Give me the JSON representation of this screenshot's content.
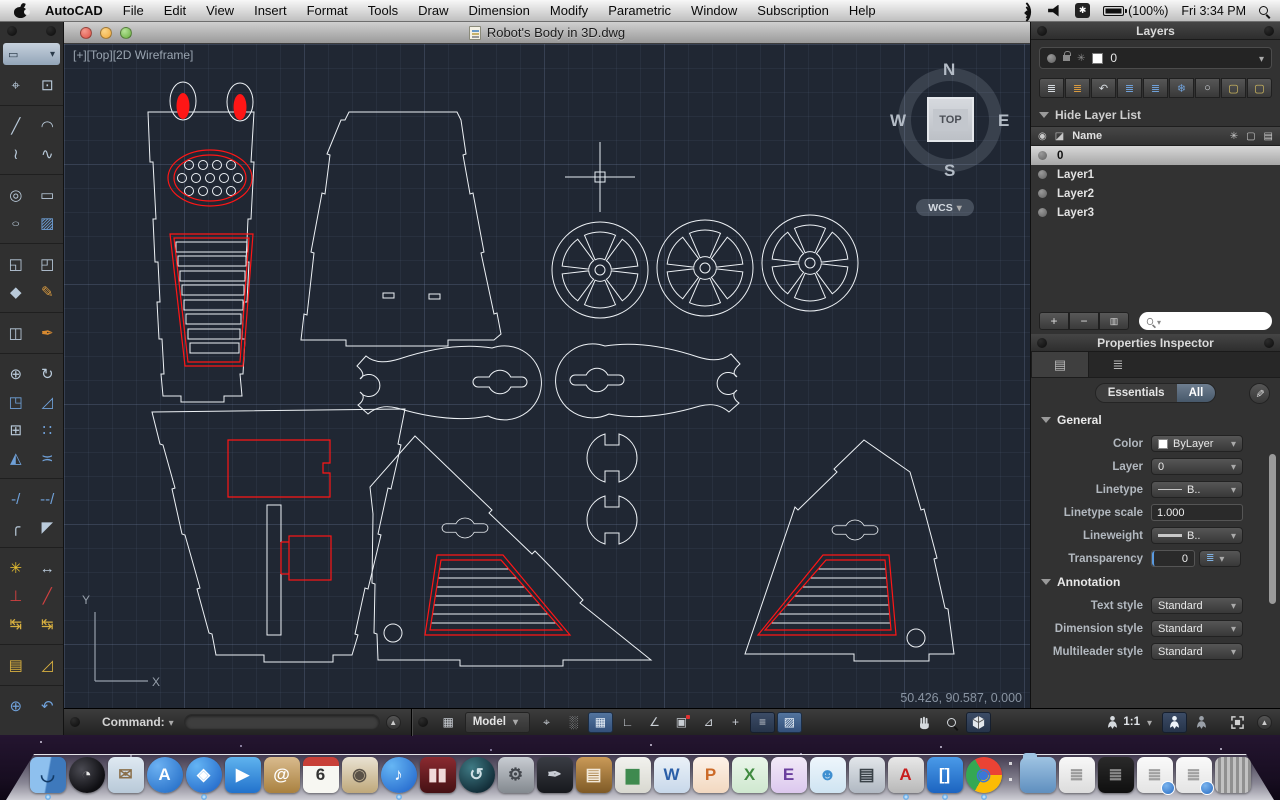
{
  "menubar": {
    "items": [
      "AutoCAD",
      "File",
      "Edit",
      "View",
      "Insert",
      "Format",
      "Tools",
      "Draw",
      "Dimension",
      "Modify",
      "Parametric",
      "Window",
      "Subscription",
      "Help"
    ],
    "battery": "(100%)",
    "clock": "Fri 3:34 PM"
  },
  "window": {
    "title": "Robot's Body in 3D.dwg",
    "viewport_label": "[+][Top][2D Wireframe]"
  },
  "compass": {
    "n": "N",
    "w": "W",
    "e": "E",
    "s": "S",
    "top": "TOP",
    "wcs": "WCS"
  },
  "canvas": {
    "coordinates": "50.426, 90.587, 0.000",
    "ucs_x": "X",
    "ucs_y": "Y",
    "background": "#202733",
    "line_color": "#edf1f5",
    "highlight_color": "#ff1616"
  },
  "layers": {
    "title": "Layers",
    "current": "0",
    "hide_label": "Hide Layer List",
    "name_col": "Name",
    "rows": [
      {
        "name": "0",
        "selected": true
      },
      {
        "name": "Layer1",
        "selected": false
      },
      {
        "name": "Layer2",
        "selected": false
      },
      {
        "name": "Layer3",
        "selected": false
      }
    ],
    "toolbar": [
      {
        "name": "layer-walk",
        "g": "≣",
        "c": "#d8dde2"
      },
      {
        "name": "layer-match",
        "g": "≣",
        "c": "#d89a40"
      },
      {
        "name": "layer-previous",
        "g": "↶",
        "c": "#d8dde2"
      },
      {
        "name": "layer-set-current",
        "g": "≣",
        "c": "#6fa0d8"
      },
      {
        "name": "layer-merge",
        "g": "≣",
        "c": "#6fa0d8"
      },
      {
        "name": "layer-freeze",
        "g": "❄",
        "c": "#6fa0d8"
      },
      {
        "name": "layer-off",
        "g": "○",
        "c": "#d8dde2"
      },
      {
        "name": "layer-lock",
        "g": "▢",
        "c": "#d8c060"
      },
      {
        "name": "layer-unlock",
        "g": "▢",
        "c": "#d8c060"
      }
    ],
    "footer": {
      "add": "+",
      "remove": "−",
      "columns": "▥"
    }
  },
  "properties": {
    "title": "Properties Inspector",
    "seg_essentials": "Essentials",
    "seg_all": "All",
    "general": {
      "title": "General",
      "color_label": "Color",
      "color_value": "ByLayer",
      "layer_label": "Layer",
      "layer_value": "0",
      "linetype_label": "Linetype",
      "linetype_value": "B..",
      "ltscale_label": "Linetype scale",
      "ltscale_value": "1.000",
      "lineweight_label": "Lineweight",
      "lineweight_value": "B..",
      "transparency_label": "Transparency",
      "transparency_value": "0"
    },
    "annotation": {
      "title": "Annotation",
      "text_style_label": "Text style",
      "text_style_value": "Standard",
      "dim_style_label": "Dimension style",
      "dim_style_value": "Standard",
      "mleader_label": "Multileader style",
      "mleader_value": "Standard"
    }
  },
  "command": {
    "label": "Command:"
  },
  "statusbar": {
    "model_label": "Model",
    "scale_label": "1:1",
    "draft": [
      {
        "name": "snap-mode",
        "g": "⌖"
      },
      {
        "name": "grid-display",
        "g": "░"
      },
      {
        "name": "grid-mode",
        "g": "▦",
        "active": true
      },
      {
        "name": "ortho-mode",
        "g": "∟"
      },
      {
        "name": "polar-tracking",
        "g": "∠"
      },
      {
        "name": "object-snap",
        "g": "▣",
        "dot": true
      },
      {
        "name": "object-snap-tracking",
        "g": "⊿"
      },
      {
        "name": "dynamic-input",
        "g": "+"
      },
      {
        "name": "lineweight-display",
        "g": "≡",
        "dark": true
      },
      {
        "name": "transparency-display",
        "g": "▨",
        "active": true
      }
    ]
  },
  "toolpalette": {
    "tools": [
      {
        "n": "point-tool",
        "g": "⌖"
      },
      {
        "n": "block-insert-tool",
        "g": "⊡"
      },
      {
        "d": true
      },
      {
        "n": "line-tool",
        "g": "╱"
      },
      {
        "n": "arc-tool",
        "g": "◠"
      },
      {
        "n": "polyline-tool",
        "g": "≀"
      },
      {
        "n": "spline-tool",
        "g": "∿"
      },
      {
        "d": true
      },
      {
        "n": "circle-tool",
        "g": "◎"
      },
      {
        "n": "rectangle-tool",
        "g": "▭"
      },
      {
        "n": "ellipse-tool",
        "g": "○",
        "cls": "ell"
      },
      {
        "n": "hatch-tool",
        "g": "▨",
        "c": "#6fa0d8"
      },
      {
        "d": true
      },
      {
        "n": "union-tool",
        "g": "◱"
      },
      {
        "n": "subtract-tool",
        "g": "◰"
      },
      {
        "n": "block-tag-tool",
        "g": "◆"
      },
      {
        "n": "attribute-edit-tool",
        "g": "✎",
        "c": "#d89a40"
      },
      {
        "d": true
      },
      {
        "n": "box-3d-tool",
        "g": "◫"
      },
      {
        "n": "paint-tool",
        "g": "✒",
        "c": "#d88a30"
      },
      {
        "d": true
      },
      {
        "n": "move-tool",
        "g": "⊕"
      },
      {
        "n": "rotate-tool",
        "g": "↻"
      },
      {
        "n": "scale-tool",
        "g": "◳",
        "c": "#6fa0d8"
      },
      {
        "n": "stretch-tool",
        "g": "◿",
        "c": "#6fa0d8"
      },
      {
        "n": "copy-tool",
        "g": "⊞"
      },
      {
        "n": "array-tool",
        "g": "∷",
        "c": "#6fa0d8"
      },
      {
        "n": "mirror-tool",
        "g": "◭",
        "c": "#6fa0d8"
      },
      {
        "n": "offset-tool",
        "g": "≍",
        "c": "#6fa0d8"
      },
      {
        "d": true
      },
      {
        "n": "trim-tool",
        "g": "-/",
        "c": "#6fa0d8"
      },
      {
        "n": "extend-tool",
        "g": "--/",
        "c": "#6fa0d8"
      },
      {
        "n": "fillet-tool",
        "g": "╭"
      },
      {
        "n": "chamfer-tool",
        "g": "◤"
      },
      {
        "d": true
      },
      {
        "n": "explode-tool",
        "g": "✳",
        "c": "#e8c030"
      },
      {
        "n": "measure-tool",
        "g": "↔"
      },
      {
        "n": "ordinate-dimension-tool",
        "g": "⊥",
        "c": "#d04040"
      },
      {
        "n": "construction-line-tool",
        "g": "╱",
        "c": "#d04040"
      },
      {
        "n": "dimension-lock-tool",
        "g": "↹",
        "c": "#d8b040"
      },
      {
        "n": "dimension-angle-lock-tool",
        "g": "↹",
        "c": "#d8b040"
      },
      {
        "d": true
      },
      {
        "n": "linear-dimension-tool",
        "g": "▤",
        "c": "#d8b040"
      },
      {
        "n": "aligned-dimension-tool",
        "g": "◿",
        "c": "#d8b040"
      },
      {
        "d": true
      },
      {
        "n": "ucs-world-tool",
        "g": "⊕",
        "c": "#6fa0d8"
      },
      {
        "n": "ucs-previous-tool",
        "g": "↶",
        "c": "#6fa0d8"
      }
    ]
  },
  "dock": {
    "items": [
      {
        "name": "finder",
        "bg": "linear-gradient(100deg,#8ec0ee 48%,#3e79bc 52%)",
        "g": "◡",
        "gc": "#123a66",
        "running": true
      },
      {
        "name": "dashboard",
        "bg": "radial-gradient(circle at 35% 35%,#4a4a52,#0e0e12 70%)",
        "g": "◔",
        "gc": "#e8e8e8",
        "shape": "circle"
      },
      {
        "name": "mail",
        "bg": "linear-gradient(#dfe9f2,#b8c9d8)",
        "g": "✉",
        "gc": "#8a6f4a"
      },
      {
        "name": "app-store",
        "bg": "radial-gradient(circle at 30% 25%,#6cb1f2,#1c66c2)",
        "g": "A",
        "gc": "#ffffff",
        "shape": "circle"
      },
      {
        "name": "safari",
        "bg": "radial-gradient(circle at 30% 25%,#64b4f4,#1a5fc4)",
        "g": "◈",
        "gc": "#ffffff",
        "shape": "circle",
        "running": true
      },
      {
        "name": "facetime",
        "bg": "linear-gradient(#5fb3ee,#2272cc)",
        "g": "▶",
        "gc": "#ffffff"
      },
      {
        "name": "address-book",
        "bg": "linear-gradient(#d9bb8e,#a9813f)",
        "g": "@",
        "gc": "#ffffff"
      },
      {
        "name": "ical",
        "bg": "linear-gradient(#c84038 0 9px,#f7f7f2 9px)",
        "g": "6",
        "gc": "#333333"
      },
      {
        "name": "iphoto",
        "bg": "linear-gradient(#e9e2d2,#bfa87a)",
        "g": "◉",
        "gc": "#5a5248"
      },
      {
        "name": "itunes",
        "bg": "radial-gradient(circle at 30% 25%,#66b6f4,#1c5fc8)",
        "g": "♪",
        "gc": "#ffffff",
        "shape": "circle",
        "running": true
      },
      {
        "name": "photo-booth",
        "bg": "linear-gradient(#8a2a30,#451114)",
        "g": "▮▮",
        "gc": "#f0d9d9"
      },
      {
        "name": "time-machine",
        "bg": "radial-gradient(circle at 35% 30%,#3f7a84,#122d38 75%)",
        "g": "↺",
        "gc": "#cfe0e6",
        "shape": "circle"
      },
      {
        "name": "system-preferences",
        "bg": "linear-gradient(#c8ccd2,#83898f)",
        "g": "⚙",
        "gc": "#42464c"
      },
      {
        "name": "ink-app",
        "bg": "linear-gradient(#3a3d44,#17191d)",
        "g": "✒",
        "gc": "#c8ccd4"
      },
      {
        "name": "keynote",
        "bg": "linear-gradient(#ca9a58,#7e5a26)",
        "g": "▤",
        "gc": "#f2e8d8"
      },
      {
        "name": "chart-app",
        "bg": "linear-gradient(#f2f2ee,#d8d8d0)",
        "g": "▆",
        "gc": "#3f8a4f"
      },
      {
        "name": "word",
        "bg": "linear-gradient(#eaf1f8,#c8d8ea)",
        "g": "W",
        "gc": "#2b5fa8"
      },
      {
        "name": "powerpoint",
        "bg": "linear-gradient(#fdf2e8,#f2d8c0)",
        "g": "P",
        "gc": "#cc6a28"
      },
      {
        "name": "excel",
        "bg": "linear-gradient(#eaf6ea,#cfe8cf)",
        "g": "X",
        "gc": "#3f8a3f"
      },
      {
        "name": "entourage",
        "bg": "linear-gradient(#f2eaf8,#dcc8ee)",
        "g": "E",
        "gc": "#6a3f9e"
      },
      {
        "name": "messenger",
        "bg": "linear-gradient(#eef6fc,#cfe4f2)",
        "g": "☻",
        "gc": "#3f8fd0"
      },
      {
        "name": "newsstand",
        "bg": "linear-gradient(#e2e6ea,#b0b8c2)",
        "g": "▤",
        "gc": "#3a4248"
      },
      {
        "name": "autocad",
        "bg": "linear-gradient(#e8e8e8,#b8b8b8)",
        "g": "A",
        "gc": "#c81e1e",
        "running": true
      },
      {
        "name": "bracket-app",
        "bg": "linear-gradient(#4a9ae8,#1c64c0)",
        "g": "[]",
        "gc": "#ffffff",
        "running": true
      },
      {
        "name": "chrome",
        "bg": "conic-gradient(from -30deg,#ea4335 0 120deg,#fbbc05 120deg 240deg,#34a853 240deg 360deg)",
        "g": "◉",
        "gc": "#3b77d8",
        "shape": "circle",
        "running": true
      },
      {
        "name": "divider"
      },
      {
        "name": "documents-folder",
        "bg": "linear-gradient(#9ec3e2,#5f8fbf)",
        "g": "",
        "gc": "#ffffff",
        "shape": "folder"
      },
      {
        "name": "documents-stack",
        "bg": "linear-gradient(#f8f8f8,#dcdcdc)",
        "g": "≣",
        "gc": "#9a9a9a"
      },
      {
        "name": "dark-document",
        "bg": "linear-gradient(#2a2a2a,#0f0f0f)",
        "g": "≣",
        "gc": "#8a8a8a"
      },
      {
        "name": "document-preview-1",
        "bg": "linear-gradient(#fafafa,#e4e4e4)",
        "g": "≣",
        "gc": "#a0a0a0",
        "shape": "badge"
      },
      {
        "name": "document-preview-2",
        "bg": "linear-gradient(#fafafa,#e4e4e4)",
        "g": "≣",
        "gc": "#a0a0a0",
        "shape": "badge"
      },
      {
        "name": "trash",
        "bg": "repeating-linear-gradient(90deg,#c2c2c2 0 3px,#909090 3px 6px)",
        "g": "",
        "gc": "#666666"
      }
    ]
  }
}
